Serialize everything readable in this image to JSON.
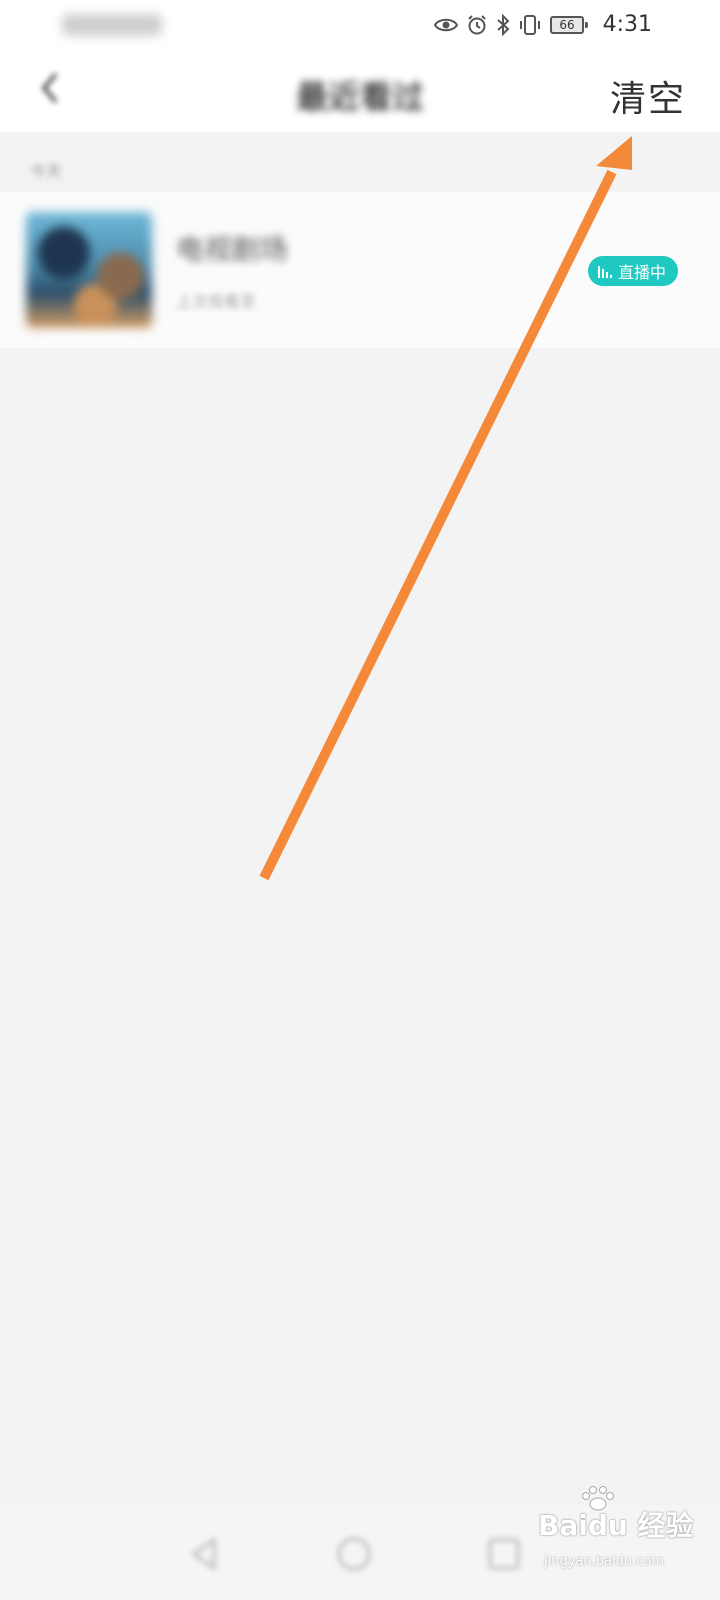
{
  "status_bar": {
    "battery": "66",
    "time": "4:31",
    "icons": [
      "eye-icon",
      "alarm-icon",
      "bluetooth-icon",
      "vibrate-icon",
      "battery-icon"
    ]
  },
  "nav": {
    "title": "最近看过",
    "clear_label": "清空",
    "back_icon": "chevron-left-icon"
  },
  "section": {
    "label": "今天"
  },
  "history": [
    {
      "title": "电视剧场",
      "subtitle": "上次观看至",
      "badge": "直播中",
      "badge_color": "#1fc9c1"
    }
  ],
  "annotation": {
    "arrow_color": "#f5893a"
  },
  "watermark": {
    "main": "Baidu 经验",
    "sub": "jingyan.baidu.com"
  },
  "bottom_nav": {
    "keys": [
      "back-triangle-icon",
      "home-circle-icon",
      "recents-square-icon"
    ]
  }
}
